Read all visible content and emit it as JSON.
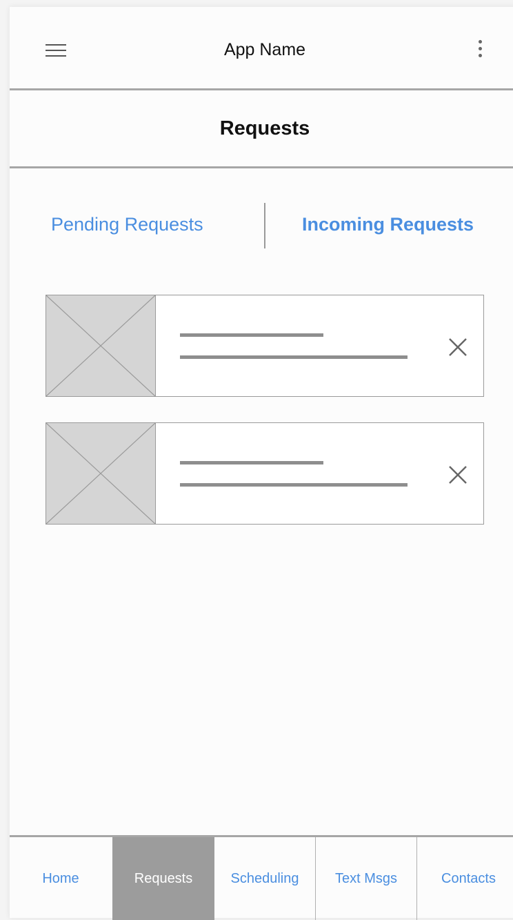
{
  "appbar": {
    "title": "App Name",
    "menu_icon": "hamburger-menu-icon",
    "overflow_icon": "kebab-menu-icon"
  },
  "page": {
    "title": "Requests"
  },
  "tabs": [
    {
      "label": "Pending Requests",
      "active": false
    },
    {
      "label": "Incoming Requests",
      "active": true
    }
  ],
  "requests": [
    {
      "thumbnail": "image-placeholder-icon",
      "action_icon": "close-icon"
    },
    {
      "thumbnail": "image-placeholder-icon",
      "action_icon": "close-icon"
    }
  ],
  "bottom_nav": {
    "items": [
      {
        "label": "Home",
        "active": false
      },
      {
        "label": "Requests",
        "active": true
      },
      {
        "label": "Scheduling",
        "active": false
      },
      {
        "label": "Text Msgs",
        "active": false
      },
      {
        "label": "Contacts",
        "active": false
      }
    ]
  },
  "colors": {
    "link": "#4a8ee0",
    "active_nav_bg": "#9c9c9c",
    "divider": "#a6a6a6",
    "placeholder_bg": "#d5d5d5"
  }
}
